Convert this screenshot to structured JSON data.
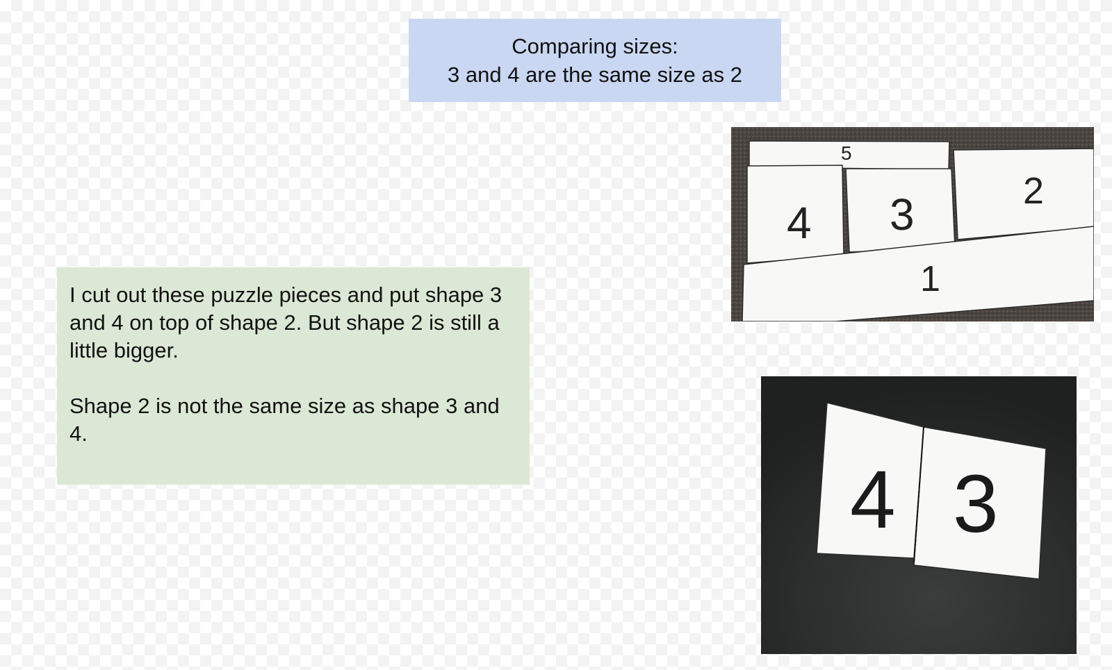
{
  "title": {
    "line1": "Comparing sizes:",
    "line2": "3 and 4 are the same size as 2"
  },
  "note": {
    "paragraph1": "I cut out these puzzle pieces and put shape 3 and 4 on top of shape 2. But shape 2 is still a little bigger.",
    "paragraph2": "Shape 2 is not the same size as shape 3 and 4."
  },
  "photo_top": {
    "piece_labels": [
      "5",
      "4",
      "3",
      "2",
      "1"
    ]
  },
  "photo_bottom": {
    "piece_labels": [
      "4",
      "3"
    ]
  },
  "colors": {
    "title_background": "#c9d7f2",
    "note_background": "#dce8d6",
    "carpet": "#4a4440",
    "table": "#2b2d2c"
  }
}
